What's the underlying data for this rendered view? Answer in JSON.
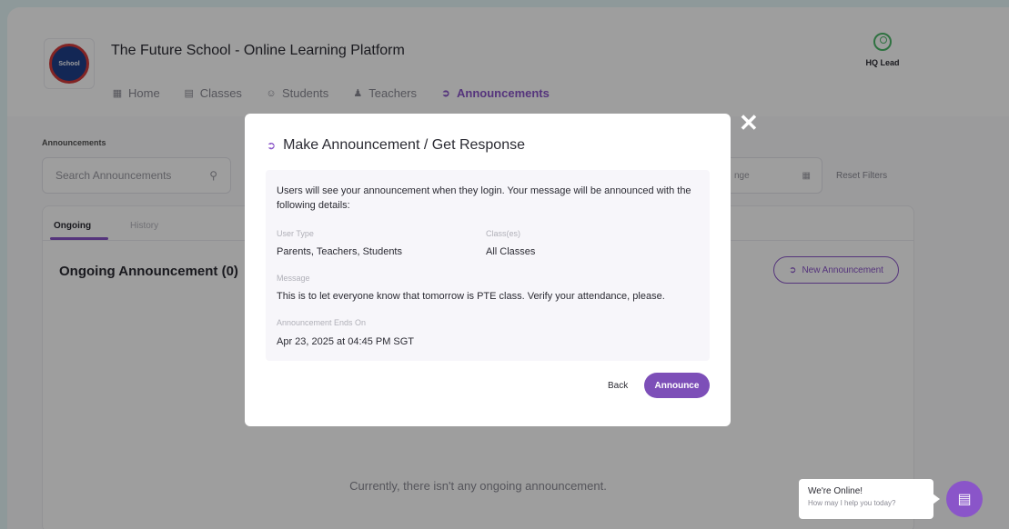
{
  "header": {
    "logo_text": "School",
    "app_title": "The Future School - Online Learning Platform",
    "user_role": "HQ Lead",
    "nav": [
      {
        "label": "Home",
        "icon": "grid-icon"
      },
      {
        "label": "Classes",
        "icon": "classes-icon"
      },
      {
        "label": "Students",
        "icon": "students-icon"
      },
      {
        "label": "Teachers",
        "icon": "teachers-icon"
      },
      {
        "label": "Announcements",
        "icon": "megaphone-icon",
        "active": true
      }
    ]
  },
  "page": {
    "section_label": "Announcements",
    "search_placeholder": "Search Announcements",
    "date_range_partial": "nge",
    "reset_filters": "Reset Filters",
    "tabs": [
      "Ongoing",
      "History"
    ],
    "ongoing_title": "Ongoing Announcement (0)",
    "new_announcement": "New Announcement",
    "empty_message": "Currently, there isn't any ongoing announcement."
  },
  "modal": {
    "title": "Make Announcement / Get Response",
    "intro": "Users will see your announcement when they login. Your message will be announced with the following details:",
    "user_type_label": "User Type",
    "user_type_value": "Parents, Teachers, Students",
    "classes_label": "Class(es)",
    "classes_value": "All Classes",
    "message_label": "Message",
    "message_value": "This is to let everyone know that tomorrow is PTE class. Verify your attendance, please.",
    "ends_label": "Announcement Ends On",
    "ends_value": "Apr 23, 2025 at 04:45 PM SGT",
    "back": "Back",
    "announce": "Announce"
  },
  "chat": {
    "status": "We're Online!",
    "prompt": "How may I help you today?"
  },
  "colors": {
    "accent": "#8a55c9",
    "button": "#7d4fb8",
    "page_bg": "#e6f7f8"
  }
}
